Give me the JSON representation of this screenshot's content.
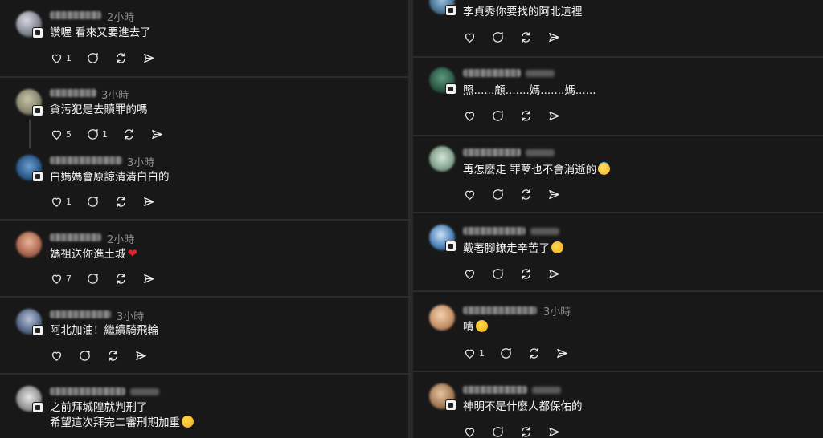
{
  "left": {
    "posts": [
      {
        "username_blurred": true,
        "time": "2小時",
        "text": "讚喔 看來又要進去了",
        "likes": "1",
        "replies": ""
      },
      {
        "username_blurred": true,
        "time": "3小時",
        "text": "貪污犯是去贖罪的嗎",
        "likes": "5",
        "replies": "1"
      },
      {
        "username_blurred": true,
        "time": "3小時",
        "text": "白媽媽會原諒清清白白的",
        "likes": "1",
        "replies": ""
      },
      {
        "username_blurred": true,
        "time": "2小時",
        "text": "媽祖送你進土城",
        "emoji": "heart",
        "likes": "7",
        "replies": ""
      },
      {
        "username_blurred": true,
        "time": "3小時",
        "text": "阿北加油！繼續騎飛輪",
        "likes": "",
        "replies": ""
      },
      {
        "username_blurred": true,
        "time": "",
        "text": "之前拜城隍就判刑了",
        "text2": "希望這次拜完二審刑期加重",
        "emoji": "woozy",
        "likes": "",
        "replies": ""
      }
    ]
  },
  "right": {
    "posts": [
      {
        "time": "",
        "text": "李貞秀你要找的阿北這裡",
        "likes": "",
        "replies": ""
      },
      {
        "time": "",
        "text": "照......顧.......媽.......媽......",
        "likes": "",
        "replies": ""
      },
      {
        "time": "",
        "text": "再怎麼走 罪孽也不會消逝的",
        "emoji": "halo",
        "likes": "",
        "replies": ""
      },
      {
        "time": "",
        "text": "戴著腳鐐走辛苦了",
        "emoji": "relieved",
        "likes": "",
        "replies": ""
      },
      {
        "time": "3小時",
        "text": "嘖",
        "emoji": "eyeroll",
        "likes": "1",
        "replies": ""
      },
      {
        "time": "",
        "text": "神明不是什麼人都保佑的",
        "likes": "",
        "replies": ""
      }
    ]
  },
  "icons": {
    "like": "heart-outline-icon",
    "reply": "comment-bubble-icon",
    "repost": "repost-arrows-icon",
    "share": "send-paper-plane-icon"
  },
  "colors": {
    "background": "#181818",
    "text": "#f3f3f3",
    "muted": "#8d8d8d",
    "heart_emoji": "#e0242e"
  }
}
